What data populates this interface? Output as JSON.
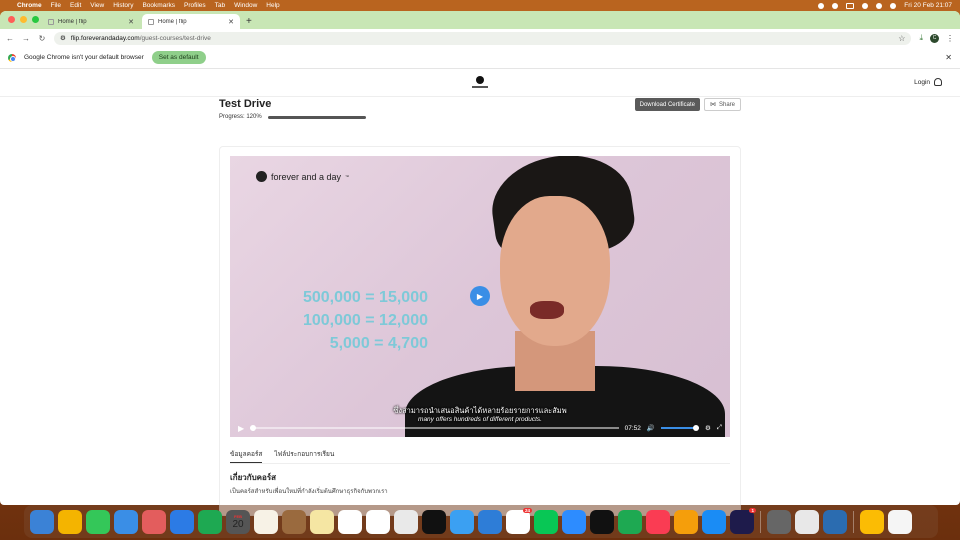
{
  "menubar": {
    "app": "Chrome",
    "items": [
      "File",
      "Edit",
      "View",
      "History",
      "Bookmarks",
      "Profiles",
      "Tab",
      "Window",
      "Help"
    ],
    "datetime": "Fri 20 Feb  21:07"
  },
  "browser": {
    "tabs": [
      {
        "label": "Home | flip",
        "active": false
      },
      {
        "label": "Home | flip",
        "active": true
      }
    ],
    "url_host": "flip.foreverandaday.com",
    "url_path": "/guest-courses/test-drive",
    "profile_initial": "C",
    "infobar_text": "Google Chrome isn't your default browser",
    "infobar_button": "Set as default"
  },
  "site": {
    "login_label": "Login",
    "page_title": "Test Drive",
    "progress_label": "Progress: 120%",
    "progress_fraction": 1.0,
    "download_button": "Download Certificate",
    "share_button": "Share"
  },
  "video": {
    "brand": "forever and a day",
    "brand_tm": "™",
    "stats": [
      "500,000 = 15,000",
      "100,000 = 12,000",
      "5,000 = 4,700"
    ],
    "subtitle_th": "ซึ่งสามารถนำเสนอสินค้าได้หลายร้อยรายการและสัมพ",
    "subtitle_en": "many offers hundreds of different products.",
    "time": "07:52",
    "volume_fraction": 0.95
  },
  "course_tabs": [
    "ข้อมูลคอร์ส",
    "ไฟล์ประกอบการเรียน"
  ],
  "about": {
    "title": "เกี่ยวกับคอร์ส",
    "desc": "เป็นคอร์สสำหรับเพื่อนใหม่ที่กำลังเริ่มต้นศึกษาธุรกิจกับพวกเรา"
  },
  "dock": {
    "calendar_month": "FEB",
    "calendar_day": "20",
    "badges": {
      "line": "24",
      "settings": "1"
    },
    "colors": [
      "#3b82d6",
      "#f4b400",
      "#34c759",
      "#3a8ee6",
      "#e35d5d",
      "#2c7be5",
      "#1ea952",
      "#555555",
      "#f7f2e6",
      "#9a6a3e",
      "#f5e6a3",
      "#ffffff",
      "#ffffff",
      "#e9e9e9",
      "#111111",
      "#3ba0f2",
      "#2e7dd7",
      "#ffffff",
      "#08c755",
      "#2d8cff",
      "#111111",
      "#1ea952",
      "#fa3c53",
      "#f59e0b",
      "#1a8cf5",
      "#1e1b4b",
      "#666666",
      "#e8e8e8",
      "#2b6cb0",
      "#fbbc04",
      "#f5f5f5",
      "#8c8c8c"
    ]
  }
}
